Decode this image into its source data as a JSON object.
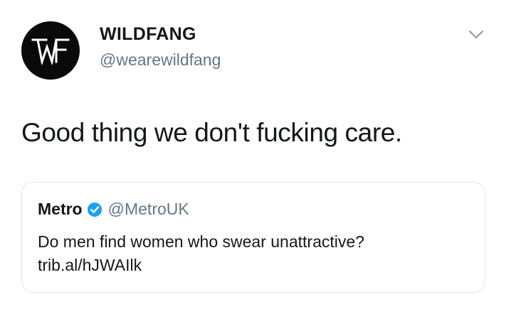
{
  "author": {
    "display_name": "WILDFANG",
    "handle": "@wearewildfang",
    "avatar_logo_text": "WF"
  },
  "caret_icon": "chevron-down-icon",
  "tweet": {
    "text": "Good thing we don't fucking care."
  },
  "quoted_tweet": {
    "name": "Metro",
    "verified_icon": "verified-badge-icon",
    "handle": "@MetroUK",
    "text": "Do men find women who swear unattractive?",
    "link": "trib.al/hJWAIlk"
  },
  "colors": {
    "text_primary": "#14171a",
    "text_secondary": "#657786",
    "card_border": "#e1e8ed",
    "verified_blue": "#1da1f2",
    "avatar_bg": "#0a0a0a"
  }
}
